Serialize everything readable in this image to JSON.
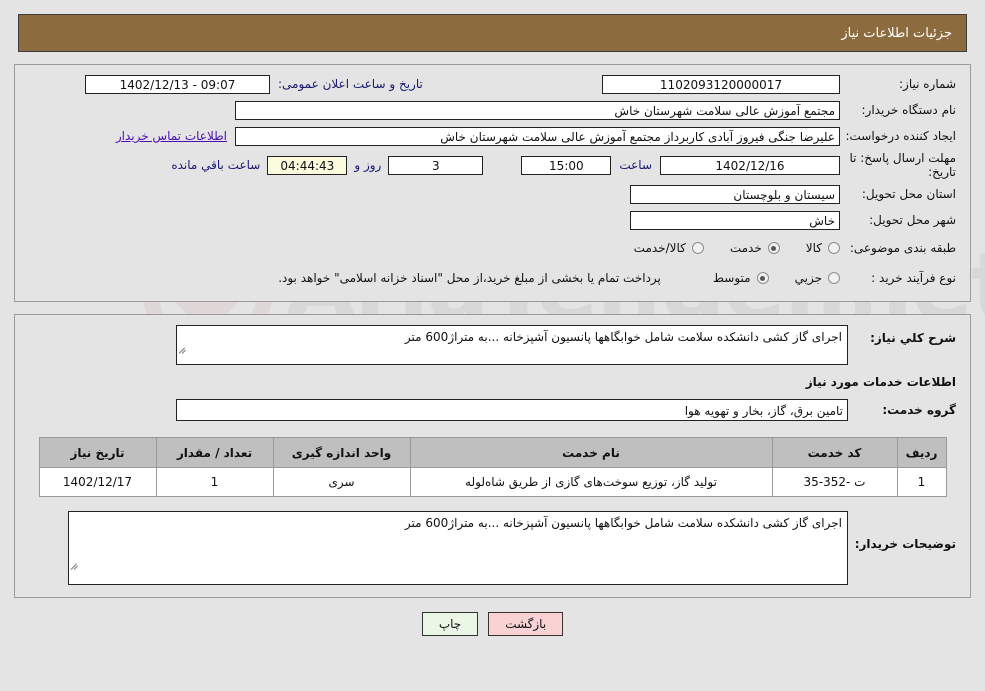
{
  "header": {
    "title": "جزئیات اطلاعات نیاز",
    "bg_color": "#8c6b3f",
    "text_color": "#ffffff"
  },
  "details": {
    "need_number_label": "شماره نیاز:",
    "need_number_value": "1102093120000017",
    "announce_datetime_label": "تاریخ و ساعت اعلان عمومی:",
    "announce_datetime_value": "09:07 - 1402/12/13",
    "buyer_org_label": "نام دستگاه خریدار:",
    "buyer_org_value": "مجتمع آموزش عالی سلامت شهرستان خاش",
    "requester_label": "ایجاد کننده درخواست:",
    "requester_value": "علیرضا جنگی فیروز آبادی کاربرداز مجتمع آموزش عالی سلامت شهرستان خاش",
    "contact_link": "اطلاعات تماس خریدار",
    "deadline_label": "مهلت ارسال پاسخ: تا تاریخ:",
    "deadline_date": "1402/12/16",
    "hour_label": "ساعت",
    "deadline_time": "15:00",
    "days_value": "3",
    "days_label": "روز و",
    "remaining_time": "04:44:43",
    "remaining_label": "ساعت باقي مانده",
    "province_label": "استان محل تحویل:",
    "province_value": "سیستان و بلوچستان",
    "city_label": "شهر محل تحویل:",
    "city_value": "خاش",
    "category_label": "طبقه بندی موضوعی:",
    "category_options": [
      {
        "label": "کالا",
        "selected": false
      },
      {
        "label": "خدمت",
        "selected": true
      },
      {
        "label": "کالا/خدمت",
        "selected": false
      }
    ],
    "process_label": "نوع فرآیند خرید :",
    "process_options": [
      {
        "label": "جزیي",
        "selected": false
      },
      {
        "label": "متوسط",
        "selected": true
      }
    ],
    "process_note": "پرداخت تمام یا بخشی از مبلغ خرید،از محل \"اسناد خزانه اسلامی\" خواهد بود."
  },
  "body": {
    "summary_label": "شرح کلي نیاز:",
    "summary_value": "اجرای گاز کشی دانشکده سلامت شامل خوابگاهها پانسیون آشپزخانه ...به متراژ600 متر",
    "services_section_title": "اطلاعات خدمات مورد نیاز",
    "service_group_label": "گروه خدمت:",
    "service_group_value": "تامین برق، گاز، بخار و تهویه هوا",
    "table": {
      "columns": [
        "ردیف",
        "کد خدمت",
        "نام خدمت",
        "واحد اندازه گیری",
        "تعداد / مقدار",
        "تاریخ نیاز"
      ],
      "rows": [
        {
          "row_no": "1",
          "service_code": "ت -352-35",
          "service_name": "تولید گاز، توزیع سوخت‌های گازی از طریق شاه‌لوله",
          "unit": "سری",
          "quantity": "1",
          "need_date": "1402/12/17"
        }
      ]
    },
    "buyer_notes_label": "توضیحات خریدار:",
    "buyer_notes_value": "اجرای گاز کشی دانشکده سلامت شامل خوابگاهها پانسیون آشپزخانه ...به متراژ600 متر"
  },
  "footer": {
    "back_label": "بازگشت",
    "print_label": "چاپ",
    "back_color": "#f9d3d3",
    "print_color": "#eaf7e6"
  },
  "watermark": {
    "text": "AriaTender.net"
  }
}
